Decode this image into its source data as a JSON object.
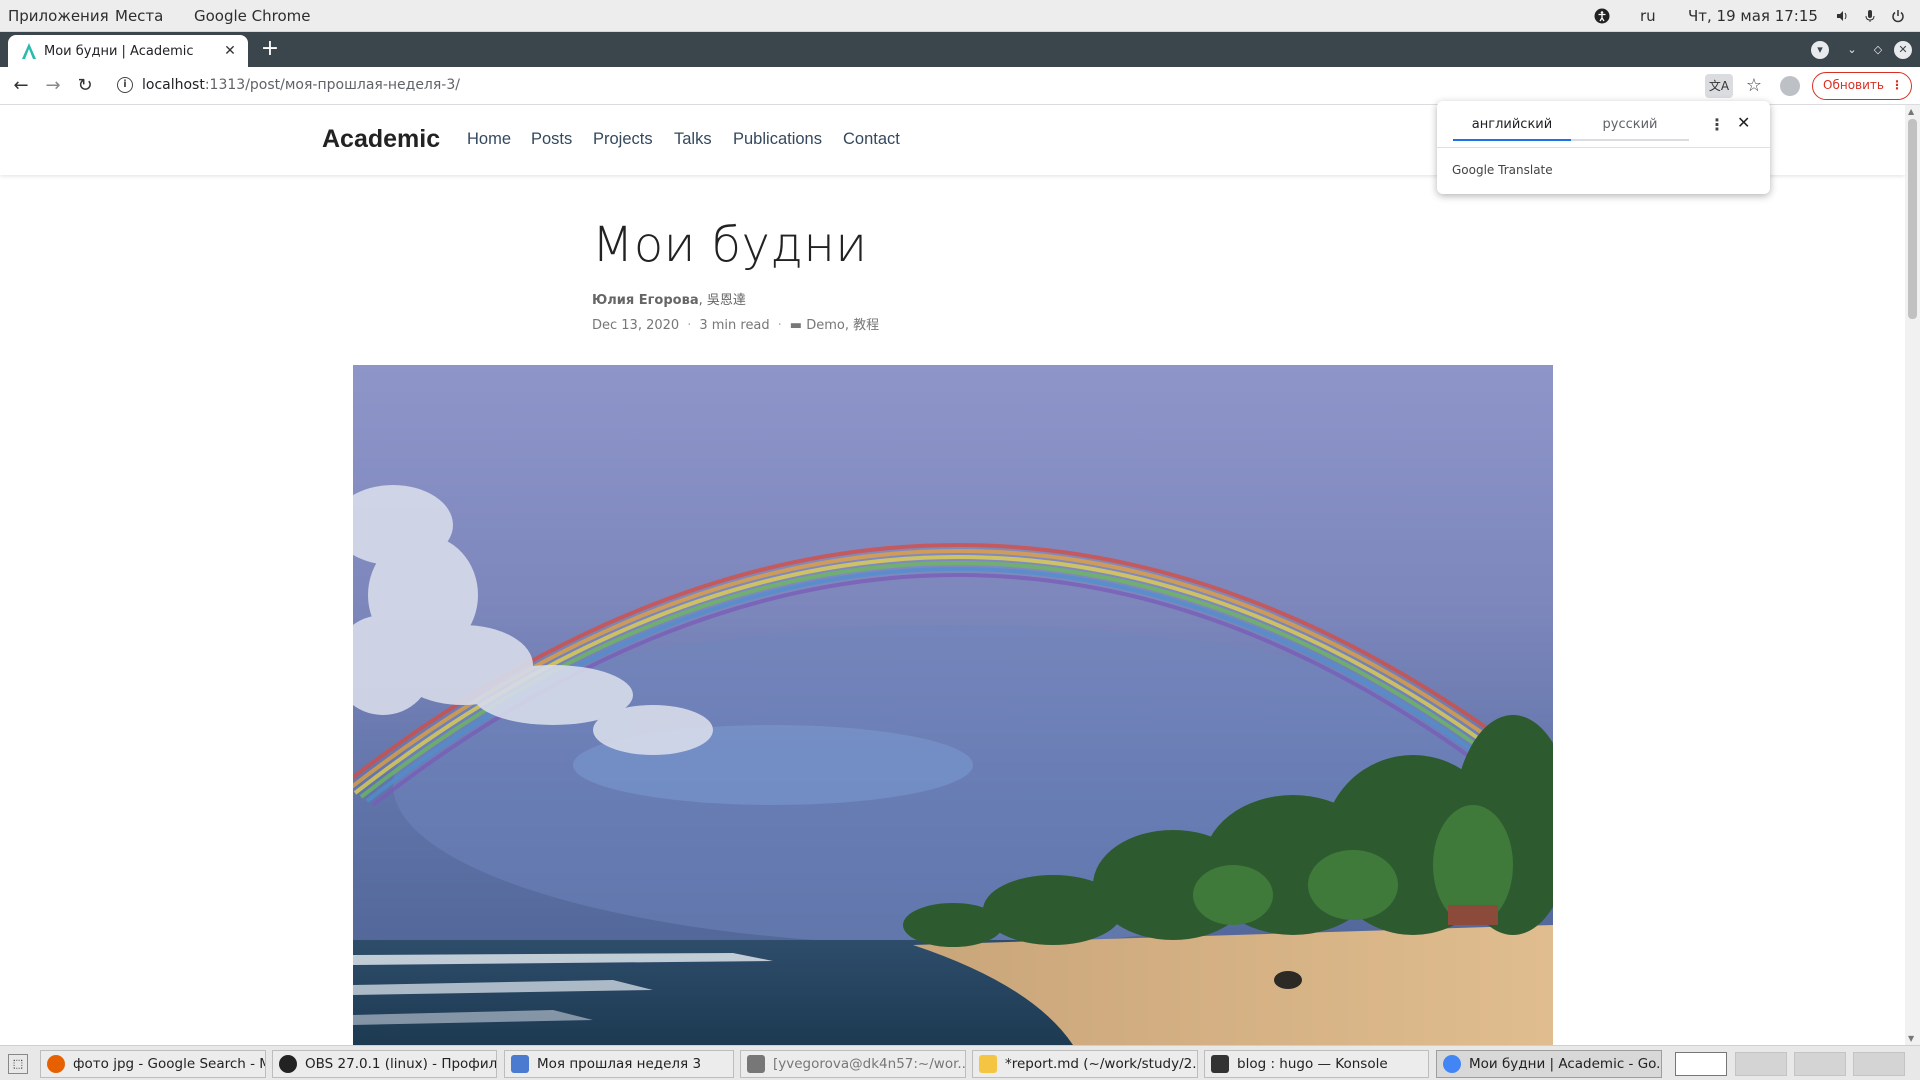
{
  "top_panel": {
    "apps_menu": "Приложения",
    "places_menu": "Места",
    "active_app": "Google Chrome",
    "lang": "ru",
    "datetime": "Чт, 19 мая  17:15"
  },
  "browser": {
    "tab_title": "Мои будни | Academic",
    "url_host": "localhost",
    "url_path": ":1313/post/моя-прошлая-неделя-3/",
    "update_label": "Обновить"
  },
  "translate": {
    "lang_from": "английский",
    "lang_to": "русский",
    "brand_google": "Google",
    "brand_translate": "Translate"
  },
  "site": {
    "brand": "Academic",
    "nav": [
      "Home",
      "Posts",
      "Projects",
      "Talks",
      "Publications",
      "Contact"
    ]
  },
  "article": {
    "title": "Мои будни",
    "author_main": "Юлия Егорова",
    "author_other": ", 吳恩達",
    "date": "Dec 13, 2020",
    "read_time": "3 min read",
    "categories": "Demo, 教程"
  },
  "taskbar": {
    "tasks": [
      "фото jpg - Google Search - M...",
      "OBS 27.0.1 (linux) - Профил...",
      "Моя прошлая неделя 3",
      "[yvegorova@dk4n57:~/wor...",
      "*report.md (~/work/study/2...",
      "blog : hugo — Konsole",
      "Мои будни | Academic - Go..."
    ]
  },
  "colors": {
    "accent": "#1a73e8",
    "update_red": "#d93025",
    "tab_strip": "#3b454c"
  }
}
